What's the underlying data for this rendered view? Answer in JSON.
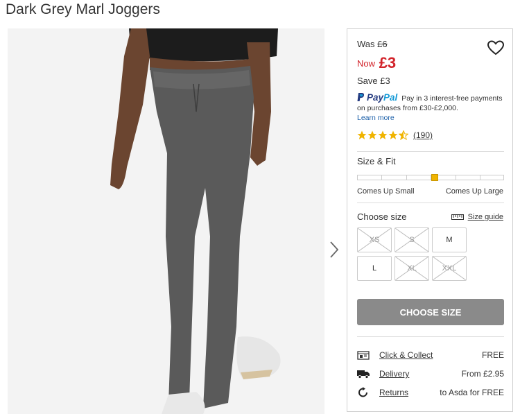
{
  "product": {
    "title": "Dark Grey Marl Joggers"
  },
  "pricing": {
    "was_label": "Was",
    "was_price": "£6",
    "now_label": "Now",
    "now_price": "£3",
    "save_label": "Save",
    "save_amount": "£3"
  },
  "paypal": {
    "logo_pay": "Pay",
    "logo_pal": "Pal",
    "text": "Pay in 3 interest-free payments on purchases from £30-£2,000.",
    "learn_more": "Learn more"
  },
  "rating": {
    "stars": 4.5,
    "count": "(190)"
  },
  "size_fit": {
    "title": "Size & Fit",
    "fit_position": 0.53,
    "left_label": "Comes Up Small",
    "right_label": "Comes Up Large"
  },
  "size_selector": {
    "title": "Choose size",
    "guide_label": "Size guide",
    "sizes": [
      {
        "label": "XS",
        "available": false
      },
      {
        "label": "S",
        "available": false
      },
      {
        "label": "M",
        "available": true
      },
      {
        "label": "L",
        "available": true
      },
      {
        "label": "XL",
        "available": false
      },
      {
        "label": "XXL",
        "available": false
      }
    ]
  },
  "cta": {
    "choose_size": "CHOOSE SIZE"
  },
  "delivery": {
    "click_collect": {
      "label": "Click & Collect",
      "value": "FREE"
    },
    "home_delivery": {
      "label": "Delivery",
      "value": "From £2.95"
    },
    "returns": {
      "label": "Returns",
      "value": "to Asda for FREE"
    }
  },
  "colors": {
    "price_red": "#d2232a",
    "star_gold": "#f0b400",
    "button_grey": "#8a8a8a",
    "link_blue": "#1a5ea8"
  }
}
